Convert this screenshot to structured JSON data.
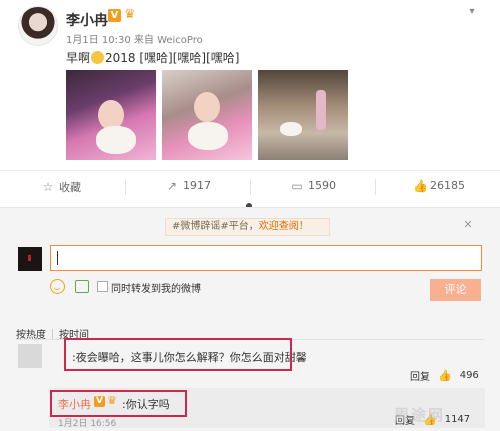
{
  "post": {
    "username": "李小冉",
    "badge": "V",
    "meta": "1月1日 10:30 来自 WeicoPro",
    "text_prefix": "早啊",
    "text_suffix": "2018 [嘿哈][嘿哈][嘿哈]"
  },
  "actions": {
    "favorite": "收藏",
    "repost_count": "1917",
    "comment_count": "1590",
    "like_count": "26185"
  },
  "comment_box": {
    "notice_prefix": "#微博辟谣#平台，",
    "notice_highlight": "欢迎查阅！",
    "repost_label": "同时转发到我的微博",
    "submit_label": "评论"
  },
  "sort": {
    "by_hot": "按热度",
    "by_time": "按时间"
  },
  "comment1": {
    "colon": ":",
    "text": "夜会曝哈，这事儿你怎么解释？你怎么面对甜馨",
    "reply_label": "回复",
    "likes": "496"
  },
  "reply1": {
    "username": "李小冉",
    "badge": "V",
    "text": ":你认字吗",
    "time": "1月2日 16:56",
    "reply_label": "回复",
    "likes": "1147"
  },
  "watermark": "周途网"
}
